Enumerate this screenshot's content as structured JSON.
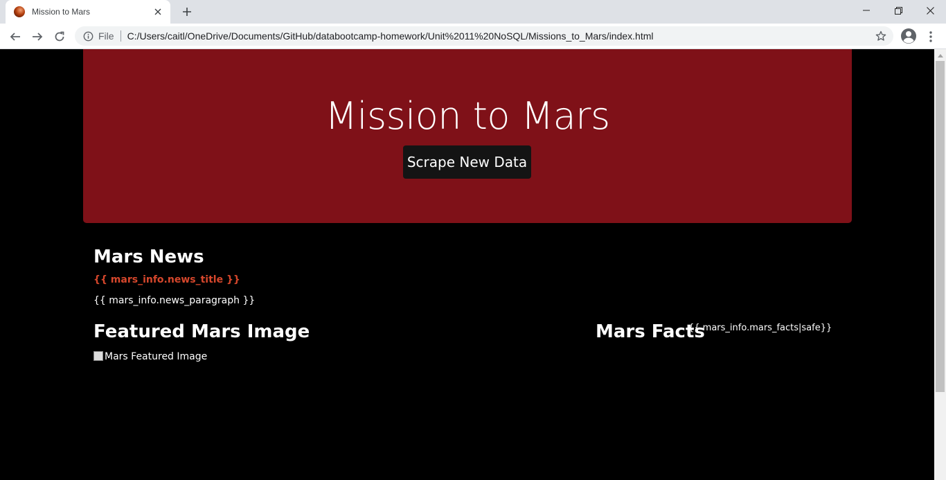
{
  "browser": {
    "tab_title": "Mission to Mars",
    "omnibox_scheme": "File",
    "url": "C:/Users/caitl/OneDrive/Documents/GitHub/databootcamp-homework/Unit%2011%20NoSQL/Missions_to_Mars/index.html"
  },
  "page": {
    "heading": "Mission to Mars",
    "scrape_button": "Scrape New Data",
    "news_heading": "Mars News",
    "news_title": "{{ mars_info.news_title }}",
    "news_paragraph": "{{ mars_info.news_paragraph }}",
    "featured_heading": "Featured Mars Image",
    "featured_image_alt": "Mars Featured Image",
    "facts_heading": "Mars Facts",
    "facts_value": "{{ mars_info.mars_facts|safe}}"
  },
  "colors": {
    "jumbotron": "#7f1118",
    "button": "#141414",
    "news_title": "#d6472c",
    "background": "#000000"
  }
}
